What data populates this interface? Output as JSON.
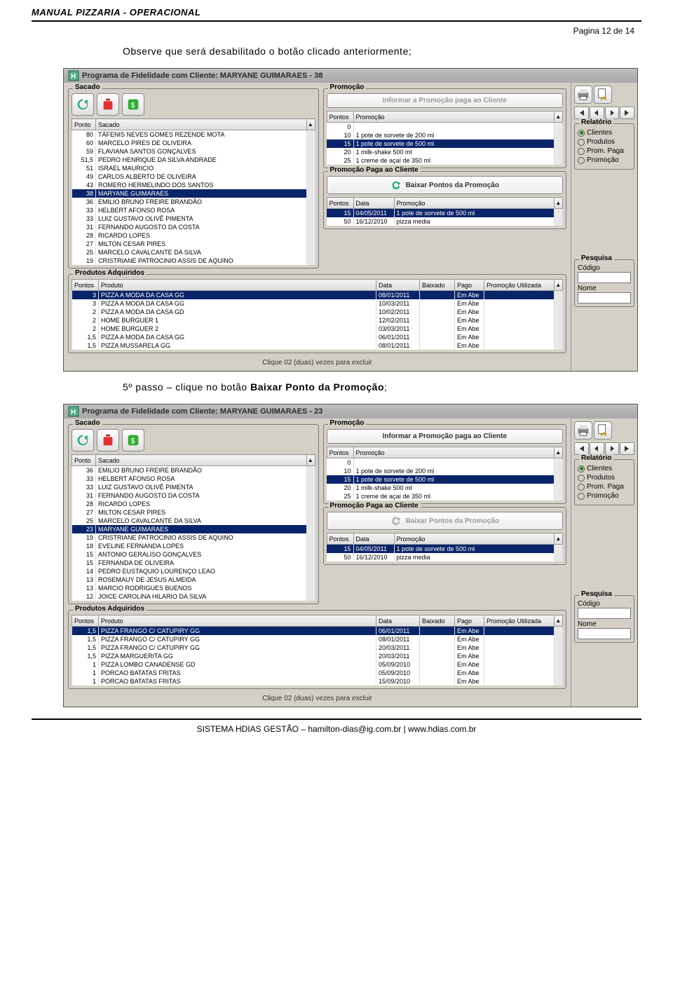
{
  "doc": {
    "header": "MANUAL PIZZARIA - OPERACIONAL",
    "page_num": "Pagina 12 de 14",
    "intro1": "Observe que será desabilitado o botão clicado anteriormente;",
    "intro2_a": "5º passo – clique no botão ",
    "intro2_b": "Baixar Ponto da Promoção",
    "intro2_c": ";",
    "footer": "SISTEMA HDIAS GESTÃO – hamilton-dias@ig.com.br | www.hdias.com.br"
  },
  "win1": {
    "title": "Programa de Fidelidade com Cliente: MARYANE GUIMARAES - 38",
    "sacado_label": "Sacado",
    "promocao_label": "Promoção",
    "promo_paga_label": "Promoção Paga ao Cliente",
    "produtos_label": "Produtos Adquiridos",
    "btn_informar": "Informar a Promoção paga ao Cliente",
    "btn_baixar": "Baixar Pontos da Promoção",
    "hint": "Clique 02 (duas) vezes para excluir",
    "sacado_cols": {
      "c0": "Ponto",
      "c1": "Sacado"
    },
    "sacado_rows": [
      {
        "p": "80",
        "n": "TÁFENIS NEVES GOMES REZENDE MOTA"
      },
      {
        "p": "60",
        "n": "MARCELO PIRES DE OLIVEIRA"
      },
      {
        "p": "59",
        "n": "FLAVIANA SANTOS GONÇALVES"
      },
      {
        "p": "51,5",
        "n": "PEDRO HENRIQUE DA SILVA ANDRADE"
      },
      {
        "p": "51",
        "n": "ISRAEL MAURICIO"
      },
      {
        "p": "49",
        "n": "CARLOS ALBERTO DE OLIVEIRA"
      },
      {
        "p": "43",
        "n": "ROMERO HERMELINDO DOS SANTOS"
      },
      {
        "p": "38",
        "n": "MARYANE GUIMARAES",
        "sel": true
      },
      {
        "p": "36",
        "n": "EMILIO BRUNO FREIRE BRANDÃO"
      },
      {
        "p": "33",
        "n": "HELBERT AFONSO ROSA"
      },
      {
        "p": "33",
        "n": "LUIZ GUSTAVO OLIVÊ PIMENTA"
      },
      {
        "p": "31",
        "n": "FERNANDO AUGOSTO DA COSTA"
      },
      {
        "p": "28",
        "n": "RICARDO LOPES"
      },
      {
        "p": "27",
        "n": "MILTON CESAR PIRES"
      },
      {
        "p": "25",
        "n": "MARCELO CAVALCANTE DA SILVA"
      },
      {
        "p": "19",
        "n": "CRISTRIANE PATROCINIO ASSIS DE AQUINO"
      }
    ],
    "promo_cols": {
      "c0": "Pontos",
      "c1": "Promoção"
    },
    "promo_rows": [
      {
        "p": "0",
        "d": ""
      },
      {
        "p": "10",
        "d": "1 pote de sorvete de 200 ml"
      },
      {
        "p": "15",
        "d": "1 pote de sorvete de 500 ml",
        "sel": true
      },
      {
        "p": "20",
        "d": "1 milk-shake 500 ml"
      },
      {
        "p": "25",
        "d": "1 creme de açaí de 350 ml"
      }
    ],
    "paga_cols": {
      "c0": "Pontos",
      "c1": "Data",
      "c2": "Promoção"
    },
    "paga_rows": [
      {
        "p": "15",
        "d": "04/05/2011",
        "t": "1 pote de sorvete de 500 ml",
        "sel": true
      },
      {
        "p": "50",
        "d": "16/12/2010",
        "t": "pizza media"
      }
    ],
    "prod_cols": {
      "c0": "Pontos",
      "c1": "Produto",
      "c2": "Data",
      "c3": "Baixado",
      "c4": "Pago",
      "c5": "Promoção Utilizada"
    },
    "prod_rows": [
      {
        "p": "3",
        "pr": "PIZZA A MODA DA CASA GG",
        "d": "08/01/2011",
        "b": "",
        "pg": "Em Abe",
        "sel": true
      },
      {
        "p": "3",
        "pr": "PIZZA A MODA DA CASA GG",
        "d": "10/03/2011",
        "b": "",
        "pg": "Em Abe"
      },
      {
        "p": "2",
        "pr": "PIZZA A MODA DA CASA GD",
        "d": "10/02/2011",
        "b": "",
        "pg": "Em Abe"
      },
      {
        "p": "2",
        "pr": "HOME BURGUER 1",
        "d": "12/02/2011",
        "b": "",
        "pg": "Em Abe"
      },
      {
        "p": "2",
        "pr": "HOME BURGUER 2",
        "d": "03/03/2011",
        "b": "",
        "pg": "Em Abe"
      },
      {
        "p": "1,5",
        "pr": "PIZZA A MODA DA CASA GG",
        "d": "06/01/2011",
        "b": "",
        "pg": "Em Abe"
      },
      {
        "p": "1,5",
        "pr": "PIZZA MUSSARELA GG",
        "d": "08/01/2011",
        "b": "",
        "pg": "Em Abe"
      }
    ]
  },
  "win2": {
    "title": "Programa de Fidelidade com Cliente: MARYANE GUIMARAES - 23",
    "sacado_rows": [
      {
        "p": "36",
        "n": "EMILIO BRUNO FREIRE BRANDÃO"
      },
      {
        "p": "33",
        "n": "HELBERT AFONSO ROSA"
      },
      {
        "p": "33",
        "n": "LUIZ GUSTAVO OLIVÊ PIMENTA"
      },
      {
        "p": "31",
        "n": "FERNANDO AUGOSTO DA COSTA"
      },
      {
        "p": "28",
        "n": "RICARDO LOPES"
      },
      {
        "p": "27",
        "n": "MILTON CESAR PIRES"
      },
      {
        "p": "25",
        "n": "MARCELO CAVALCANTE DA SILVA"
      },
      {
        "p": "23",
        "n": "MARYANE GUIMARAES",
        "sel": true
      },
      {
        "p": "19",
        "n": "CRISTRIANE PATROCINIO ASSIS DE AQUINO"
      },
      {
        "p": "18",
        "n": "EVELINE FERNANDA LOPES"
      },
      {
        "p": "15",
        "n": "ANTONIO GERALISO GONÇALVES"
      },
      {
        "p": "15",
        "n": "FERNANDA DE OLIVEIRA"
      },
      {
        "p": "14",
        "n": "PEDRO EUSTAQUIO  LOURENÇO LEAO"
      },
      {
        "p": "13",
        "n": "ROSEMAUY DE JESUS ALMEIDA"
      },
      {
        "p": "13",
        "n": "MARCIO RODRIGUES BUENOS"
      },
      {
        "p": "12",
        "n": "JOICE CAROLINA HILARIO DA SILVA"
      }
    ],
    "prod_rows": [
      {
        "p": "1,5",
        "pr": "PIZZA FRANGO C/ CATUPIRY GG",
        "d": "06/01/2011",
        "b": "",
        "pg": "Em Abe",
        "sel": true
      },
      {
        "p": "1,5",
        "pr": "PIZZA FRANGO C/ CATUPIRY GG",
        "d": "08/01/2011",
        "b": "",
        "pg": "Em Abe"
      },
      {
        "p": "1,5",
        "pr": "PIZZA FRANGO C/ CATUPIRY GG",
        "d": "20/03/2011",
        "b": "",
        "pg": "Em Abe"
      },
      {
        "p": "1,5",
        "pr": "PIZZA MARGUERITA GG",
        "d": "20/03/2011",
        "b": "",
        "pg": "Em Abe"
      },
      {
        "p": "1",
        "pr": "PIZZA LOMBO CANADENSE GD",
        "d": "05/09/2010",
        "b": "",
        "pg": "Em Abe"
      },
      {
        "p": "1",
        "pr": "PORCAO BATATAS FRITAS",
        "d": "05/09/2010",
        "b": "",
        "pg": "Em Abe"
      },
      {
        "p": "1",
        "pr": "PORCAO BATATAS FRITAS",
        "d": "15/09/2010",
        "b": "",
        "pg": "Em Abe"
      }
    ]
  },
  "side": {
    "relatorio_label": "Relatório",
    "r0": "Clientes",
    "r1": "Produtos",
    "r2": "Prom. Paga",
    "r3": "Promoção",
    "pesquisa_label": "Pesquisa",
    "codigo_label": "Código",
    "nome_label": "Nome"
  }
}
